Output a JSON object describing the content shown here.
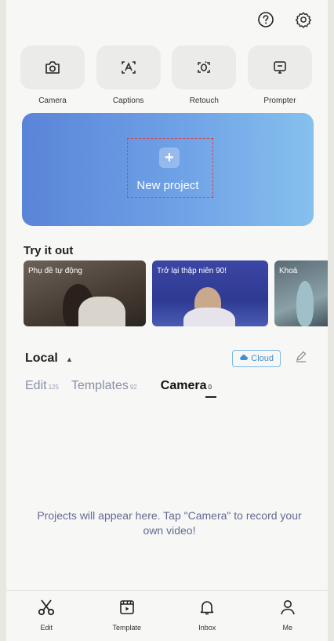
{
  "header": {
    "help_icon": "question-circle-icon",
    "settings_icon": "gear-icon"
  },
  "tools": [
    {
      "label": "Camera",
      "icon": "camera-icon"
    },
    {
      "label": "Captions",
      "icon": "captions-icon"
    },
    {
      "label": "Retouch",
      "icon": "retouch-icon"
    },
    {
      "label": "Prompter",
      "icon": "prompter-icon"
    }
  ],
  "new_project": {
    "label": "New project",
    "icon": "plus-icon"
  },
  "try_it_out": {
    "title": "Try it out",
    "cards": [
      {
        "caption": "Phụ đề tự động"
      },
      {
        "caption": "Trở lại thập niên 90!"
      },
      {
        "caption": "Khoá"
      }
    ]
  },
  "local": {
    "title": "Local",
    "cloud_label": "Cloud",
    "tabs": [
      {
        "label": "Edit",
        "count": "125"
      },
      {
        "label": "Templates",
        "count": "92"
      },
      {
        "label": "Camera",
        "count": "0"
      }
    ],
    "active_tab": "Camera",
    "empty_message": "Projects will appear here. Tap \"Camera\" to record your own video!"
  },
  "bottom_nav": [
    {
      "label": "Edit",
      "icon": "scissors-icon"
    },
    {
      "label": "Template",
      "icon": "template-icon"
    },
    {
      "label": "Inbox",
      "icon": "bell-icon"
    },
    {
      "label": "Me",
      "icon": "person-icon"
    }
  ],
  "colors": {
    "accent_blue": "#3f8fd2",
    "banner_start": "#5a84d8",
    "banner_end": "#86c0ee"
  }
}
